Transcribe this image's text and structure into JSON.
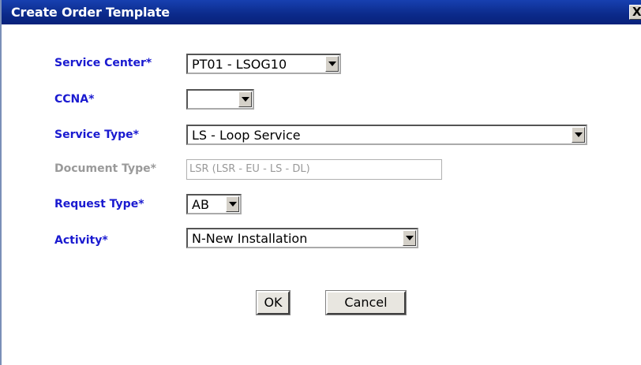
{
  "dialog": {
    "title": "Create Order Template",
    "close_label": "X"
  },
  "form": {
    "service_center": {
      "label": "Service Center*",
      "value": "PT01 - LSOG10"
    },
    "ccna": {
      "label": "CCNA*",
      "value": ""
    },
    "service_type": {
      "label": "Service Type*",
      "value": "LS - Loop Service"
    },
    "document_type": {
      "label": "Document Type*",
      "value": "LSR (LSR - EU - LS - DL)"
    },
    "request_type": {
      "label": "Request Type*",
      "value": "AB"
    },
    "activity": {
      "label": "Activity*",
      "value": "N-New Installation"
    }
  },
  "buttons": {
    "ok_label": "OK",
    "cancel_label": "Cancel"
  },
  "colors": {
    "title_bar": "#0b2a8a",
    "required_label": "#1a1ad0",
    "disabled_label": "#9a9a9a"
  }
}
